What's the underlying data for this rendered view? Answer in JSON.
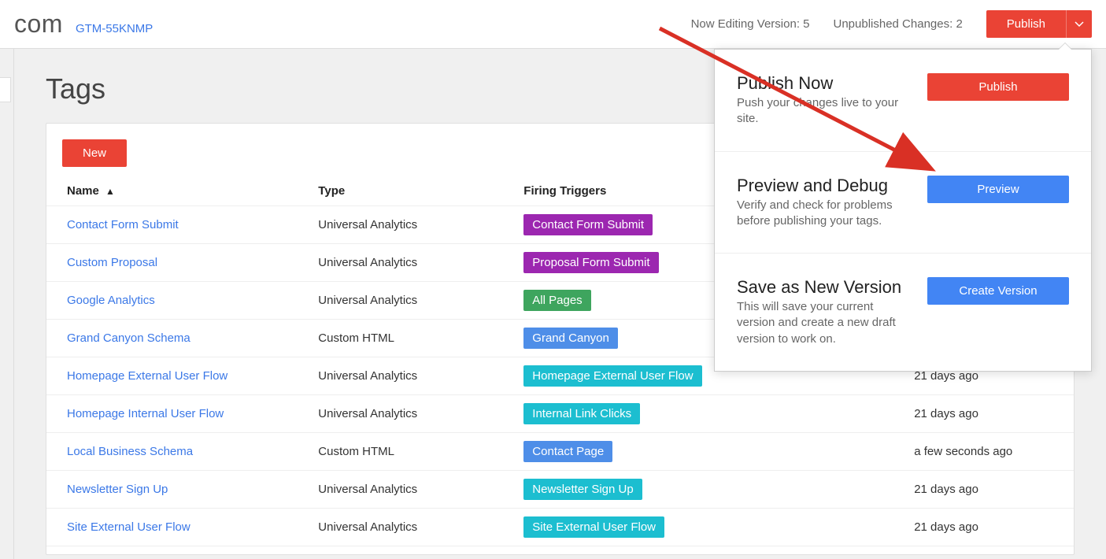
{
  "header": {
    "domain_suffix": "com",
    "container_id": "GTM-55KNMP",
    "version_label": "Now Editing Version: 5",
    "changes_label": "Unpublished Changes: 2",
    "publish_label": "Publish"
  },
  "page": {
    "title": "Tags",
    "new_button": "New"
  },
  "columns": {
    "name": "Name",
    "type": "Type",
    "triggers": "Firing Triggers",
    "edited": ""
  },
  "tags": [
    {
      "name": "Contact Form Submit",
      "type": "Universal Analytics",
      "trigger": "Contact Form Submit",
      "trigger_color": "#9c27b0",
      "edited": ""
    },
    {
      "name": "Custom Proposal",
      "type": "Universal Analytics",
      "trigger": "Proposal Form Submit",
      "trigger_color": "#9c27b0",
      "edited": ""
    },
    {
      "name": "Google Analytics",
      "type": "Universal Analytics",
      "trigger": "All Pages",
      "trigger_color": "#3ea55e",
      "edited": ""
    },
    {
      "name": "Grand Canyon Schema",
      "type": "Custom HTML",
      "trigger": "Grand Canyon",
      "trigger_color": "#4e8ee8",
      "edited": ""
    },
    {
      "name": "Homepage External User Flow",
      "type": "Universal Analytics",
      "trigger": "Homepage External User Flow",
      "trigger_color": "#1cbed0",
      "edited": "21 days ago"
    },
    {
      "name": "Homepage Internal User Flow",
      "type": "Universal Analytics",
      "trigger": "Internal Link Clicks",
      "trigger_color": "#1cbed0",
      "edited": "21 days ago"
    },
    {
      "name": "Local Business Schema",
      "type": "Custom HTML",
      "trigger": "Contact Page",
      "trigger_color": "#4e8ee8",
      "edited": "a few seconds ago"
    },
    {
      "name": "Newsletter Sign Up",
      "type": "Universal Analytics",
      "trigger": "Newsletter Sign Up",
      "trigger_color": "#1cbed0",
      "edited": "21 days ago"
    },
    {
      "name": "Site External User Flow",
      "type": "Universal Analytics",
      "trigger": "Site External User Flow",
      "trigger_color": "#1cbed0",
      "edited": "21 days ago"
    }
  ],
  "dropdown": {
    "publish": {
      "title": "Publish Now",
      "desc": "Push your changes live to your site.",
      "button": "Publish"
    },
    "preview": {
      "title": "Preview and Debug",
      "desc": "Verify and check for problems before publishing your tags.",
      "button": "Preview"
    },
    "version": {
      "title": "Save as New Version",
      "desc": "This will save your current version and create a new draft version to work on.",
      "button": "Create Version"
    }
  }
}
